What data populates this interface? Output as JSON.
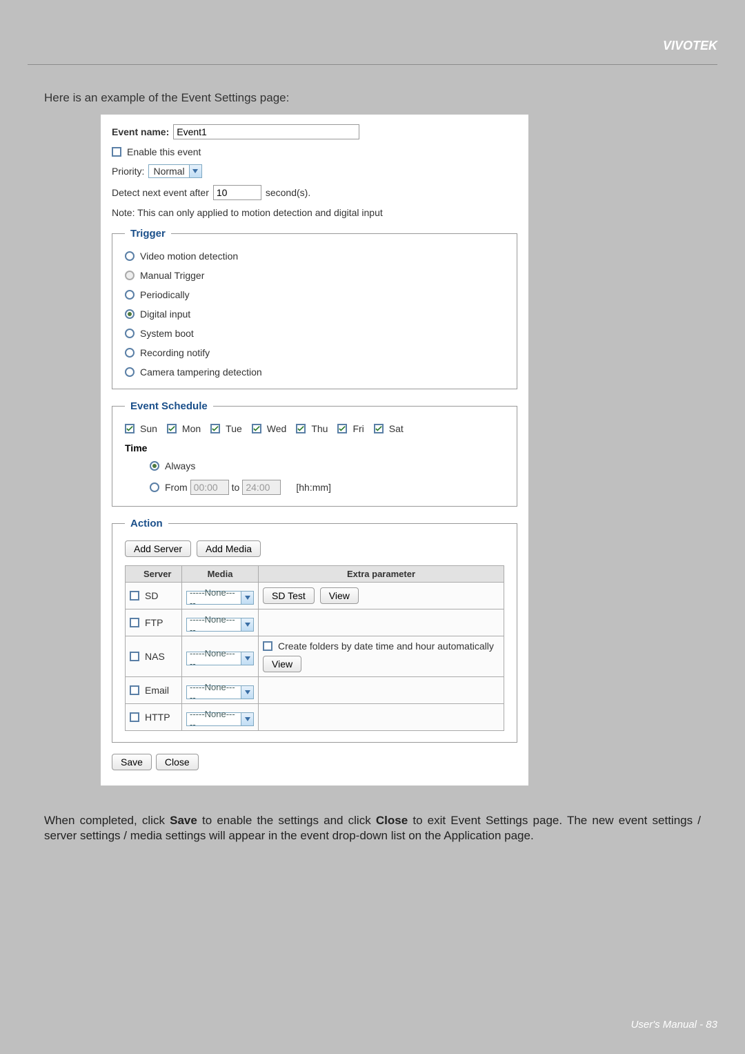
{
  "brand": "VIVOTEK",
  "intro": "Here is an example of the Event Settings page:",
  "event": {
    "name_label": "Event name:",
    "name_value": "Event1",
    "enable_label": "Enable this event",
    "priority_label": "Priority:",
    "priority_value": "Normal",
    "detect_label_pre": "Detect next event after",
    "detect_value": "10",
    "detect_label_post": "second(s).",
    "note": "Note: This can only applied to motion detection and digital input"
  },
  "trigger": {
    "legend": "Trigger",
    "options": {
      "video_motion": "Video motion detection",
      "manual": "Manual Trigger",
      "periodically": "Periodically",
      "digital_input": "Digital input",
      "system_boot": "System boot",
      "recording_notify": "Recording notify",
      "camera_tampering": "Camera tampering detection"
    }
  },
  "schedule": {
    "legend": "Event Schedule",
    "days": {
      "sun": "Sun",
      "mon": "Mon",
      "tue": "Tue",
      "wed": "Wed",
      "thu": "Thu",
      "fri": "Fri",
      "sat": "Sat"
    },
    "time_label": "Time",
    "always": "Always",
    "from_label": "From",
    "from_value": "00:00",
    "to_label": "to",
    "to_value": "24:00",
    "format": "[hh:mm]"
  },
  "action": {
    "legend": "Action",
    "add_server": "Add Server",
    "add_media": "Add Media",
    "headers": {
      "server": "Server",
      "media": "Media",
      "extra": "Extra parameter"
    },
    "rows": {
      "sd": {
        "label": "SD",
        "media": "-----None-----",
        "sd_test": "SD Test",
        "view": "View"
      },
      "ftp": {
        "label": "FTP",
        "media": "-----None-----"
      },
      "nas": {
        "label": "NAS",
        "media": "-----None-----",
        "folders": "Create folders by date time and hour automatically",
        "view": "View"
      },
      "email": {
        "label": "Email",
        "media": "-----None-----"
      },
      "http": {
        "label": "HTTP",
        "media": "-----None-----"
      }
    }
  },
  "buttons": {
    "save": "Save",
    "close": "Close"
  },
  "closing": {
    "p1_pre": "When completed, click ",
    "save_b": "Save",
    "p1_mid": " to enable the settings and click ",
    "close_b": "Close",
    "p1_post": " to exit Event Settings page. The new event settings / server settings / media settings will appear in the event drop-down list on the Application page."
  },
  "footer": "User's Manual - 83"
}
